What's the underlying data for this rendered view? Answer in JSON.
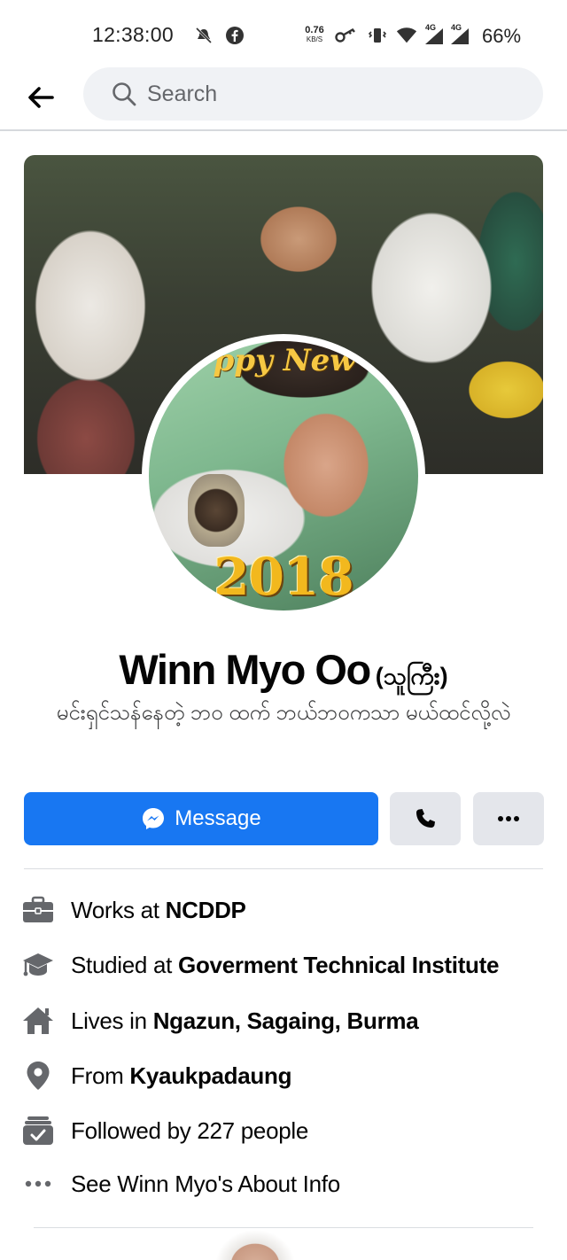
{
  "status_bar": {
    "time": "12:38:00",
    "net_speed_value": "0.76",
    "net_speed_unit": "KB/S",
    "network_1": "4G",
    "network_2": "4G",
    "battery": "66%"
  },
  "search": {
    "placeholder": "Search"
  },
  "profile": {
    "name": "Winn Myo Oo",
    "alternate_name": "(သူကြီး)",
    "bio": "မင်းရှင်သန်နေတဲ့ ဘဝ ထက် ဘယ်ဘဝကသာ မယ်ထင်လို့လဲ",
    "avatar_greeting": "ppy New",
    "avatar_year": "2018"
  },
  "actions": {
    "message_label": "Message"
  },
  "details": [
    {
      "icon": "briefcase-icon",
      "prefix": "Works at",
      "value": "NCDDP"
    },
    {
      "icon": "graduation-cap-icon",
      "prefix": "Studied at",
      "value": "Goverment Technical Institute"
    },
    {
      "icon": "home-icon",
      "prefix": "Lives in",
      "value": "Ngazun, Sagaing, Burma"
    },
    {
      "icon": "location-pin-icon",
      "prefix": "From",
      "value": "Kyaukpadaung"
    },
    {
      "icon": "followers-icon",
      "prefix": "Followed by 227 people",
      "value": ""
    },
    {
      "icon": "more-dots-icon",
      "prefix": "See Winn Myo's About Info",
      "value": ""
    }
  ],
  "colors": {
    "primary": "#1877f2",
    "secondary_button": "#e4e6eb",
    "search_bg": "#f0f2f5",
    "icon_gray": "#65676b",
    "text": "#050505"
  }
}
